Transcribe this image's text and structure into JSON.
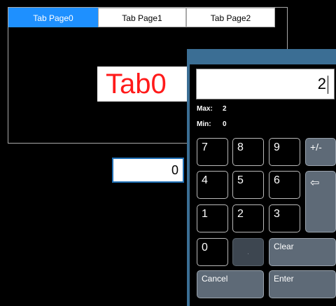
{
  "tabs": [
    {
      "label": "Tab Page0",
      "active": true
    },
    {
      "label": "Tab Page1",
      "active": false
    },
    {
      "label": "Tab Page2",
      "active": false
    }
  ],
  "tab_content": {
    "label": "Tab0",
    "color": "#ff1a1a"
  },
  "numeric_field": {
    "value": "0"
  },
  "keypad": {
    "display_value": "2",
    "max_label": "Max:",
    "max_value": "2",
    "min_label": "Min:",
    "min_value": "0",
    "keys": {
      "k7": "7",
      "k8": "8",
      "k9": "9",
      "sign": "+/-",
      "k4": "4",
      "k5": "5",
      "k6": "6",
      "backspace": "⇦",
      "k1": "1",
      "k2": "2",
      "k3": "3",
      "k0": "0",
      "dot": ".",
      "clear": "Clear",
      "cancel": "Cancel",
      "enter": "Enter"
    }
  },
  "colors": {
    "active_tab": "#1e90ff",
    "popup_frame": "#3b6e94",
    "gray_key": "#5e6a77"
  }
}
